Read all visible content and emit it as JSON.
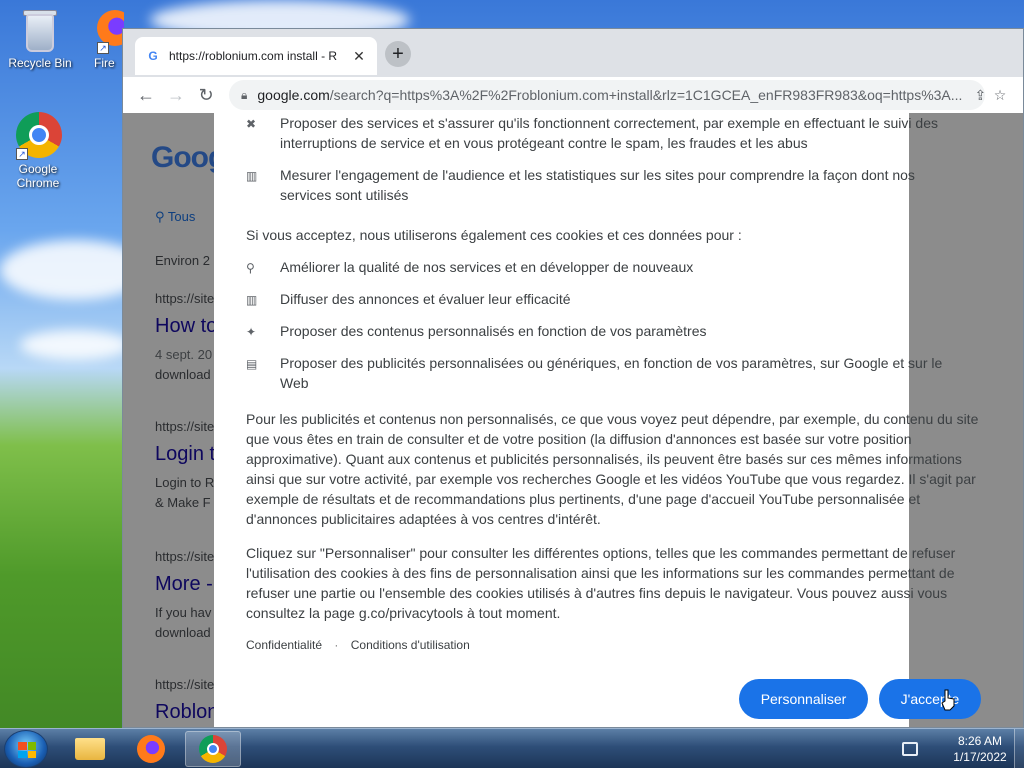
{
  "desktop": {
    "icons": [
      {
        "label": "Recycle Bin"
      },
      {
        "label": "Fire"
      },
      {
        "label": "Google Chrome"
      }
    ]
  },
  "browser": {
    "tab_title": "https://roblonium.com install - R",
    "tab_close": "✕",
    "new_tab": "+",
    "url_host": "google.com",
    "url_rest": "/search?q=https%3A%2F%2Froblonium.com+install&rlz=1C1GCEA_enFR983FR983&oq=https%3A..."
  },
  "background_page": {
    "logo": "Goog",
    "tab_all": "Tous",
    "about": "Environ 2",
    "results": [
      {
        "url": "https://site",
        "title": "How to",
        "snippet1": "4 sept. 20",
        "snippet2": "download"
      },
      {
        "url": "https://site",
        "title": "Login t",
        "snippet1": "Login to R",
        "snippet2": "& Make F"
      },
      {
        "url": "https://site",
        "title": "More -",
        "snippet1": "If you hav",
        "snippet2": "download"
      },
      {
        "url": "https://site",
        "title": "Roblon",
        "snippet1": "",
        "snippet2": ""
      }
    ]
  },
  "consent": {
    "items_top": [
      {
        "icon": "tools-icon",
        "glyph": "✖",
        "text": "Proposer des services et s'assurer qu'ils fonctionnent correctement, par exemple en effectuant le suivi des interruptions de service et en vous protégeant contre le spam, les fraudes et les abus"
      },
      {
        "icon": "analytics-icon",
        "glyph": "▥",
        "text": "Mesurer l'engagement de l'audience et les statistiques sur les sites pour comprendre la façon dont nos services sont utilisés"
      }
    ],
    "if_accept_heading": "Si vous acceptez, nous utiliserons également ces cookies et ces données pour :",
    "items_accept": [
      {
        "icon": "search-icon",
        "glyph": "⚲",
        "text": "Améliorer la qualité de nos services et en développer de nouveaux"
      },
      {
        "icon": "chart-icon",
        "glyph": "▥",
        "text": "Diffuser des annonces et évaluer leur efficacité"
      },
      {
        "icon": "sparkle-icon",
        "glyph": "✦",
        "text": "Proposer des contenus personnalisés en fonction de vos paramètres"
      },
      {
        "icon": "ad-icon",
        "glyph": "▤",
        "text": "Proposer des publicités personnalisées ou génériques, en fonction de vos paramètres, sur Google et sur le Web"
      }
    ],
    "paragraph1": "Pour les publicités et contenus non personnalisés, ce que vous voyez peut dépendre, par exemple, du contenu du site que vous êtes en train de consulter et de votre position (la diffusion d'annonces est basée sur votre position approximative). Quant aux contenus et publicités personnalisés, ils peuvent être basés sur ces mêmes informations ainsi que sur votre activité, par exemple vos recherches Google et les vidéos YouTube que vous regardez. Il s'agit par exemple de résultats et de recommandations plus pertinents, d'une page d'accueil YouTube personnalisée et d'annonces publicitaires adaptées à vos centres d'intérêt.",
    "paragraph2": "Cliquez sur \"Personnaliser\" pour consulter les différentes options, telles que les commandes permettant de refuser l'utilisation des cookies à des fins de personnalisation ainsi que les informations sur les commandes permettant de refuser une partie ou l'ensemble des cookies utilisés à d'autres fins depuis le navigateur. Vous pouvez aussi vous consultez la page g.co/privacytools à tout moment.",
    "link_privacy": "Confidentialité",
    "link_separator": "·",
    "link_terms": "Conditions d'utilisation",
    "btn_customize": "Personnaliser",
    "btn_accept": "J'accepte",
    "accent": "#1a73e8"
  },
  "taskbar": {
    "time": "8:26 AM",
    "date": "1/17/2022"
  }
}
